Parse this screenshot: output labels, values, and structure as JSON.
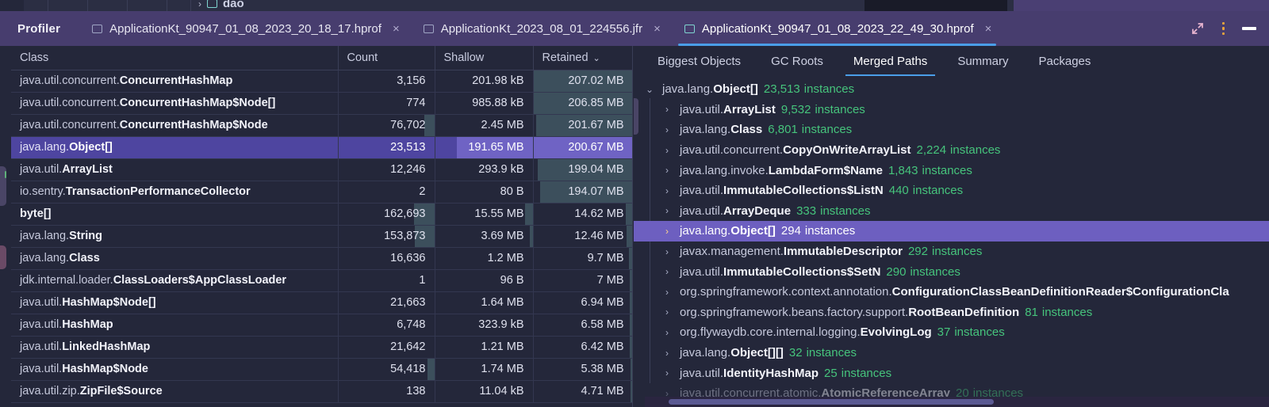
{
  "window": {
    "app_label": "Profiler",
    "controls": {
      "expand_icon": "expand-arrows-icon",
      "menu_icon": "kebab-menu-icon",
      "minimize_icon": "minimize-icon"
    }
  },
  "top_strip": {
    "chevron": "›",
    "folder_icon": "folder-icon",
    "label": "dao"
  },
  "tabs": [
    {
      "title": "ApplicationKt_90947_01_08_2023_20_18_17.hprof",
      "close": "×",
      "active": false
    },
    {
      "title": "ApplicationKt_2023_08_01_224556.jfr",
      "close": "×",
      "active": false
    },
    {
      "title": "ApplicationKt_90947_01_08_2023_22_49_30.hprof",
      "close": "×",
      "active": true
    }
  ],
  "table": {
    "columns": [
      {
        "label": "Class",
        "sorted": false
      },
      {
        "label": "Count",
        "sorted": false
      },
      {
        "label": "Shallow",
        "sorted": false
      },
      {
        "label": "Retained",
        "sorted": true
      }
    ],
    "sort_caret": "⌄",
    "rows": [
      {
        "pkg": "java.util.concurrent.",
        "name": "ConcurrentHashMap",
        "count": "3,156",
        "shallow": "201.98 kB",
        "retained": "207.02 MB",
        "count_bar": 0,
        "shallow_bar": 0,
        "retained_bar": 100,
        "selected": false
      },
      {
        "pkg": "java.util.concurrent.",
        "name": "ConcurrentHashMap$Node[]",
        "count": "774",
        "shallow": "985.88 kB",
        "retained": "206.85 MB",
        "count_bar": 0,
        "shallow_bar": 0,
        "retained_bar": 100,
        "selected": false
      },
      {
        "pkg": "java.util.concurrent.",
        "name": "ConcurrentHashMap$Node",
        "count": "76,702",
        "shallow": "2.45 MB",
        "retained": "201.67 MB",
        "count_bar": 10,
        "shallow_bar": 0,
        "retained_bar": 97,
        "selected": false
      },
      {
        "pkg": "java.lang.",
        "name": "Object[]",
        "count": "23,513",
        "shallow": "191.65 MB",
        "retained": "200.67 MB",
        "count_bar": 0,
        "shallow_bar": 78,
        "retained_bar": 100,
        "selected": true
      },
      {
        "pkg": "java.util.",
        "name": "ArrayList",
        "count": "12,246",
        "shallow": "293.9 kB",
        "retained": "199.04 MB",
        "count_bar": 0,
        "shallow_bar": 0,
        "retained_bar": 96,
        "selected": false
      },
      {
        "pkg": "io.sentry.",
        "name": "TransactionPerformanceCollector",
        "count": "2",
        "shallow": "80 B",
        "retained": "194.07 MB",
        "count_bar": 0,
        "shallow_bar": 0,
        "retained_bar": 93,
        "selected": false
      },
      {
        "pkg": "",
        "name": "byte[]",
        "count": "162,693",
        "shallow": "15.55 MB",
        "retained": "14.62 MB",
        "count_bar": 21,
        "shallow_bar": 8,
        "retained_bar": 7,
        "selected": false
      },
      {
        "pkg": "java.lang.",
        "name": "String",
        "count": "153,873",
        "shallow": "3.69 MB",
        "retained": "12.46 MB",
        "count_bar": 20,
        "shallow_bar": 3,
        "retained_bar": 6,
        "selected": false
      },
      {
        "pkg": "java.lang.",
        "name": "Class",
        "count": "16,636",
        "shallow": "1.2 MB",
        "retained": "9.7 MB",
        "count_bar": 0,
        "shallow_bar": 0,
        "retained_bar": 4,
        "selected": false
      },
      {
        "pkg": "jdk.internal.loader.",
        "name": "ClassLoaders$AppClassLoader",
        "count": "1",
        "shallow": "96 B",
        "retained": "7 MB",
        "count_bar": 0,
        "shallow_bar": 0,
        "retained_bar": 3,
        "selected": false
      },
      {
        "pkg": "java.util.",
        "name": "HashMap$Node[]",
        "count": "21,663",
        "shallow": "1.64 MB",
        "retained": "6.94 MB",
        "count_bar": 0,
        "shallow_bar": 0,
        "retained_bar": 3,
        "selected": false
      },
      {
        "pkg": "java.util.",
        "name": "HashMap",
        "count": "6,748",
        "shallow": "323.9 kB",
        "retained": "6.58 MB",
        "count_bar": 0,
        "shallow_bar": 0,
        "retained_bar": 3,
        "selected": false
      },
      {
        "pkg": "java.util.",
        "name": "LinkedHashMap",
        "count": "21,642",
        "shallow": "1.21 MB",
        "retained": "6.42 MB",
        "count_bar": 0,
        "shallow_bar": 0,
        "retained_bar": 3,
        "selected": false
      },
      {
        "pkg": "java.util.",
        "name": "HashMap$Node",
        "count": "54,418",
        "shallow": "1.74 MB",
        "retained": "5.38 MB",
        "count_bar": 7,
        "shallow_bar": 0,
        "retained_bar": 2,
        "selected": false
      },
      {
        "pkg": "java.util.zip.",
        "name": "ZipFile$Source",
        "count": "138",
        "shallow": "11.04 kB",
        "retained": "4.71 MB",
        "count_bar": 0,
        "shallow_bar": 0,
        "retained_bar": 2,
        "selected": false
      }
    ]
  },
  "right_panel": {
    "tabs": [
      {
        "label": "Biggest Objects",
        "active": false
      },
      {
        "label": "GC Roots",
        "active": false
      },
      {
        "label": "Merged Paths",
        "active": true
      },
      {
        "label": "Summary",
        "active": false
      },
      {
        "label": "Packages",
        "active": false
      }
    ],
    "tree": [
      {
        "depth": 0,
        "twisty": "⌄",
        "expanded": true,
        "pkg": "java.lang.",
        "name": "Object[]",
        "count": "23,513",
        "instances": "instances",
        "selected": false,
        "clipped": false
      },
      {
        "depth": 1,
        "twisty": "›",
        "expanded": false,
        "pkg": "java.util.",
        "name": "ArrayList",
        "count": "9,532",
        "instances": "instances",
        "selected": false,
        "clipped": false
      },
      {
        "depth": 1,
        "twisty": "›",
        "expanded": false,
        "pkg": "java.lang.",
        "name": "Class",
        "count": "6,801",
        "instances": "instances",
        "selected": false,
        "clipped": false
      },
      {
        "depth": 1,
        "twisty": "›",
        "expanded": false,
        "pkg": "java.util.concurrent.",
        "name": "CopyOnWriteArrayList",
        "count": "2,224",
        "instances": "instances",
        "selected": false,
        "clipped": false
      },
      {
        "depth": 1,
        "twisty": "›",
        "expanded": false,
        "pkg": "java.lang.invoke.",
        "name": "LambdaForm$Name",
        "count": "1,843",
        "instances": "instances",
        "selected": false,
        "clipped": false
      },
      {
        "depth": 1,
        "twisty": "›",
        "expanded": false,
        "pkg": "java.util.",
        "name": "ImmutableCollections$ListN",
        "count": "440",
        "instances": "instances",
        "selected": false,
        "clipped": false
      },
      {
        "depth": 1,
        "twisty": "›",
        "expanded": false,
        "pkg": "java.util.",
        "name": "ArrayDeque",
        "count": "333",
        "instances": "instances",
        "selected": false,
        "clipped": false
      },
      {
        "depth": 1,
        "twisty": "›",
        "expanded": false,
        "pkg": "java.lang.",
        "name": "Object[]",
        "count": "294",
        "instances": "instances",
        "selected": true,
        "clipped": false
      },
      {
        "depth": 1,
        "twisty": "›",
        "expanded": false,
        "pkg": "javax.management.",
        "name": "ImmutableDescriptor",
        "count": "292",
        "instances": "instances",
        "selected": false,
        "clipped": false
      },
      {
        "depth": 1,
        "twisty": "›",
        "expanded": false,
        "pkg": "java.util.",
        "name": "ImmutableCollections$SetN",
        "count": "290",
        "instances": "instances",
        "selected": false,
        "clipped": false
      },
      {
        "depth": 1,
        "twisty": "›",
        "expanded": false,
        "pkg": "org.springframework.context.annotation.",
        "name": "ConfigurationClassBeanDefinitionReader$ConfigurationCla",
        "count": "",
        "instances": "",
        "selected": false,
        "clipped": false
      },
      {
        "depth": 1,
        "twisty": "›",
        "expanded": false,
        "pkg": "org.springframework.beans.factory.support.",
        "name": "RootBeanDefinition",
        "count": "81",
        "instances": "instances",
        "selected": false,
        "clipped": false
      },
      {
        "depth": 1,
        "twisty": "›",
        "expanded": false,
        "pkg": "org.flywaydb.core.internal.logging.",
        "name": "EvolvingLog",
        "count": "37",
        "instances": "instances",
        "selected": false,
        "clipped": false
      },
      {
        "depth": 1,
        "twisty": "›",
        "expanded": false,
        "pkg": "java.lang.",
        "name": "Object[][]",
        "count": "32",
        "instances": "instances",
        "selected": false,
        "clipped": false
      },
      {
        "depth": 1,
        "twisty": "›",
        "expanded": false,
        "pkg": "java.util.",
        "name": "IdentityHashMap",
        "count": "25",
        "instances": "instances",
        "selected": false,
        "clipped": false
      },
      {
        "depth": 1,
        "twisty": "›",
        "expanded": false,
        "pkg": "java.util.concurrent.atomic.",
        "name": "AtomicReferenceArray",
        "count": "20",
        "instances": "instances",
        "selected": false,
        "clipped": true
      }
    ]
  },
  "colors": {
    "titlebar": "#473d6e",
    "accent_blue": "#4a9ee8",
    "selection_purple": "#4e45a0",
    "tree_selection": "#6d5fc0",
    "count_green": "#46c47c",
    "bar_teal": "#3c4f5c",
    "background": "#24273a"
  }
}
